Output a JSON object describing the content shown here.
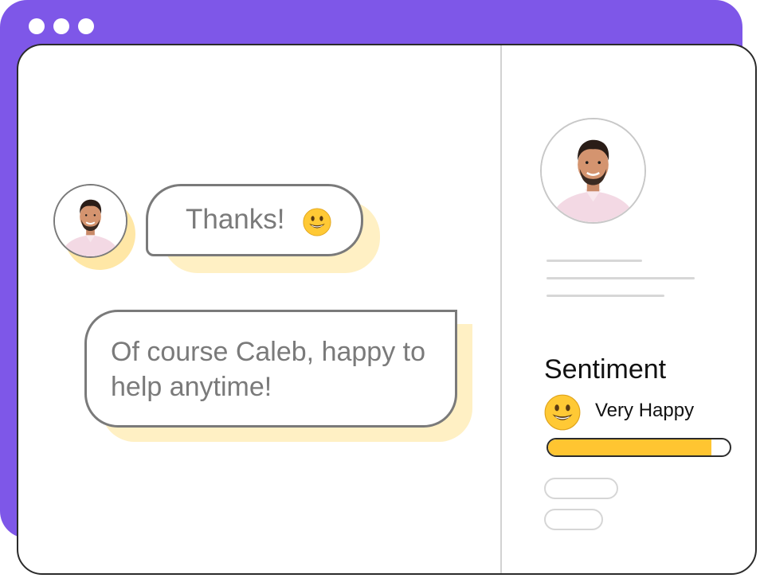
{
  "window": {
    "accent_color": "#7e57e8",
    "controls": [
      "dot",
      "dot",
      "dot"
    ]
  },
  "chat": {
    "messages": [
      {
        "sender": "customer",
        "text": "Thanks!",
        "emoji": "smiling-face-emoji"
      },
      {
        "sender": "agent",
        "text": "Of course Caleb, happy to help anytime!"
      }
    ]
  },
  "profile": {
    "avatar": "customer-avatar"
  },
  "sentiment": {
    "title": "Sentiment",
    "label": "Very Happy",
    "emoji": "grinning-face-emoji",
    "score": 0.9,
    "bar_color": "#ffc531"
  }
}
